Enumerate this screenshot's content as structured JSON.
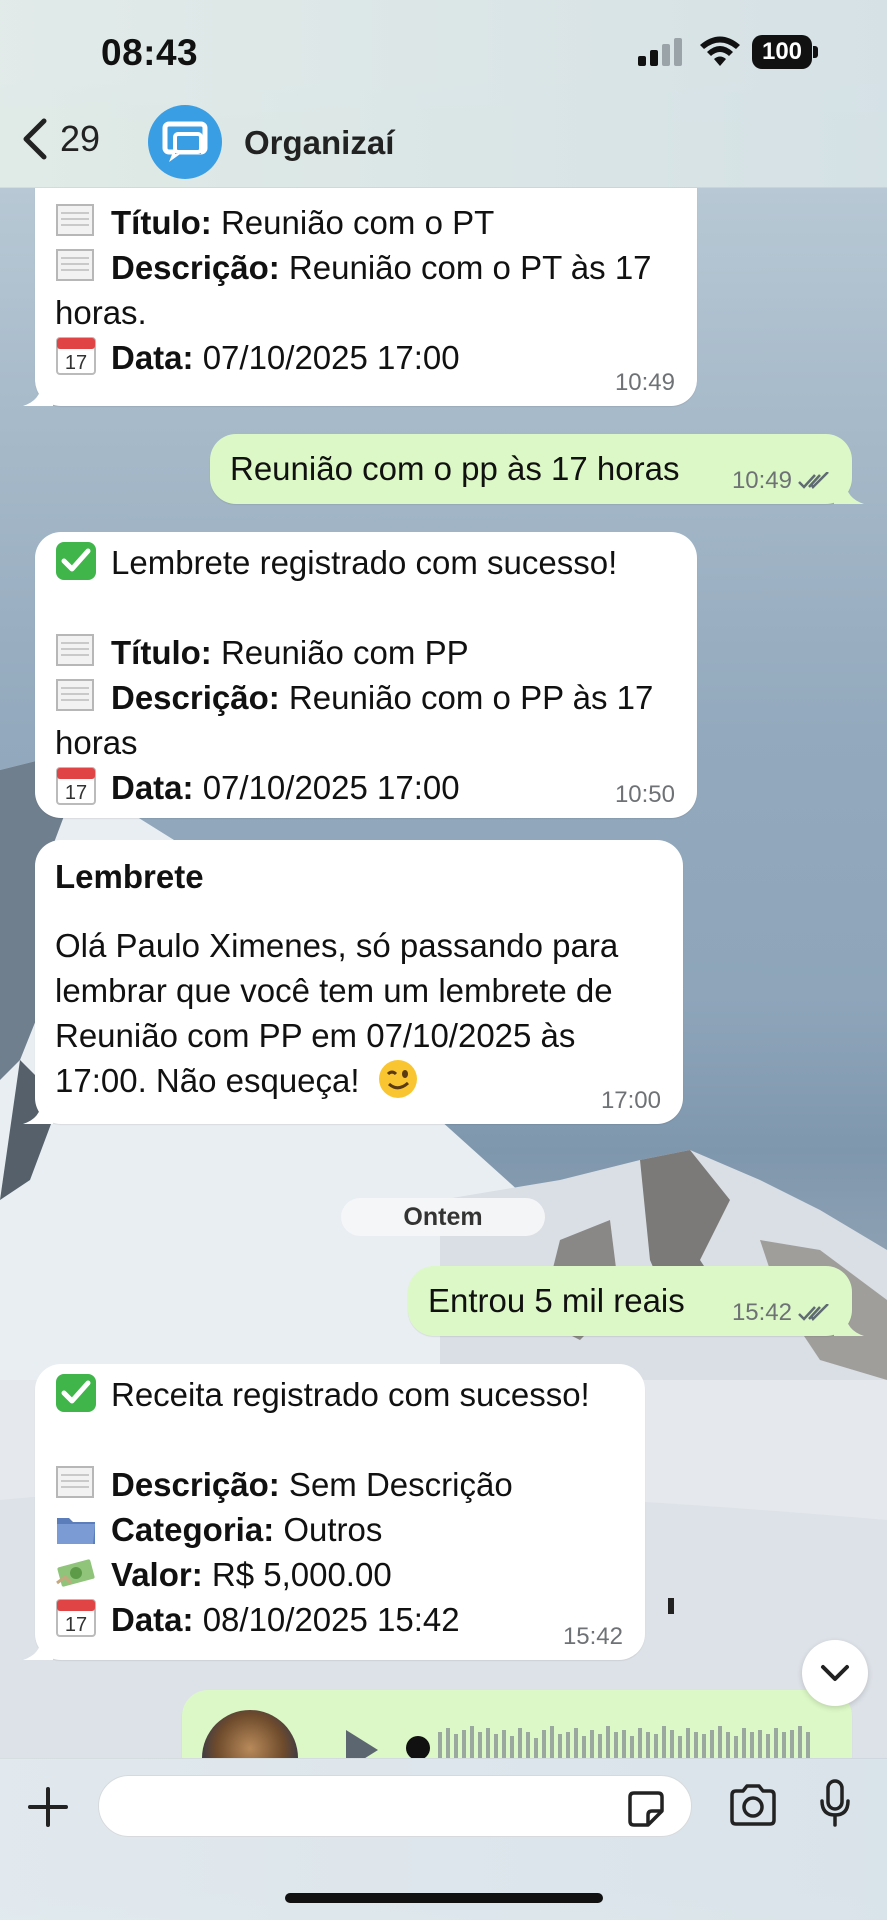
{
  "status_bar": {
    "time": "08:43",
    "battery": "100"
  },
  "header": {
    "back_count": "29",
    "chat_name": "Organizaí"
  },
  "messages": {
    "m1": {
      "title_label": "Título:",
      "title_value": " Reunião com o PT",
      "desc_label": "Descrição:",
      "desc_value_1": " Reunião com o PT às 17",
      "desc_value_2": "horas.",
      "date_label": "Data:",
      "date_value": " 07/10/2025 17:00",
      "time": "10:49"
    },
    "m2": {
      "text": "Reunião com o pp às 17 horas",
      "time": "10:49"
    },
    "m3": {
      "headline": "Lembrete registrado com sucesso!",
      "title_label": "Título:",
      "title_value": " Reunião com PP",
      "desc_label": "Descrição:",
      "desc_value_1": " Reunião com o PP às 17",
      "desc_value_2": "horas",
      "date_label": "Data:",
      "date_value": " 07/10/2025 17:00",
      "time": "10:50"
    },
    "m4": {
      "heading": "Lembrete",
      "line1": "Olá Paulo Ximenes, só passando para",
      "line2": "lembrar que você tem um lembrete de",
      "line3": "Reunião com PP em 07/10/2025 às",
      "line4": "17:00. Não esqueça!",
      "time": "17:00"
    },
    "date_separator": "Ontem",
    "m5": {
      "text": "Entrou 5 mil reais",
      "time": "15:42"
    },
    "m6": {
      "headline": "Receita registrado com sucesso!",
      "desc_label": "Descrição:",
      "desc_value": " Sem Descrição",
      "cat_label": "Categoria:",
      "cat_value": " Outros",
      "value_label": "Valor:",
      "value_value": " R$ 5,000.00",
      "date_label": "Data:",
      "date_value": " 08/10/2025 15:42",
      "time": "15:42"
    }
  },
  "input": {
    "placeholder": ""
  },
  "colors": {
    "incoming": "#ffffff",
    "outgoing": "#dcf8c6",
    "app_blue": "#3a9ee4",
    "read_ticks": "#5f6b72"
  },
  "icons": [
    "back-chevron-icon",
    "signal-icon",
    "wifi-icon",
    "battery-icon",
    "chat-bubble-icon",
    "page-icon",
    "calendar-icon",
    "check-mark-icon",
    "folder-icon",
    "money-icon",
    "wink-emoji-icon",
    "double-check-icon",
    "chevron-down-icon",
    "plus-icon",
    "sticker-icon",
    "camera-icon",
    "microphone-icon",
    "play-icon"
  ]
}
